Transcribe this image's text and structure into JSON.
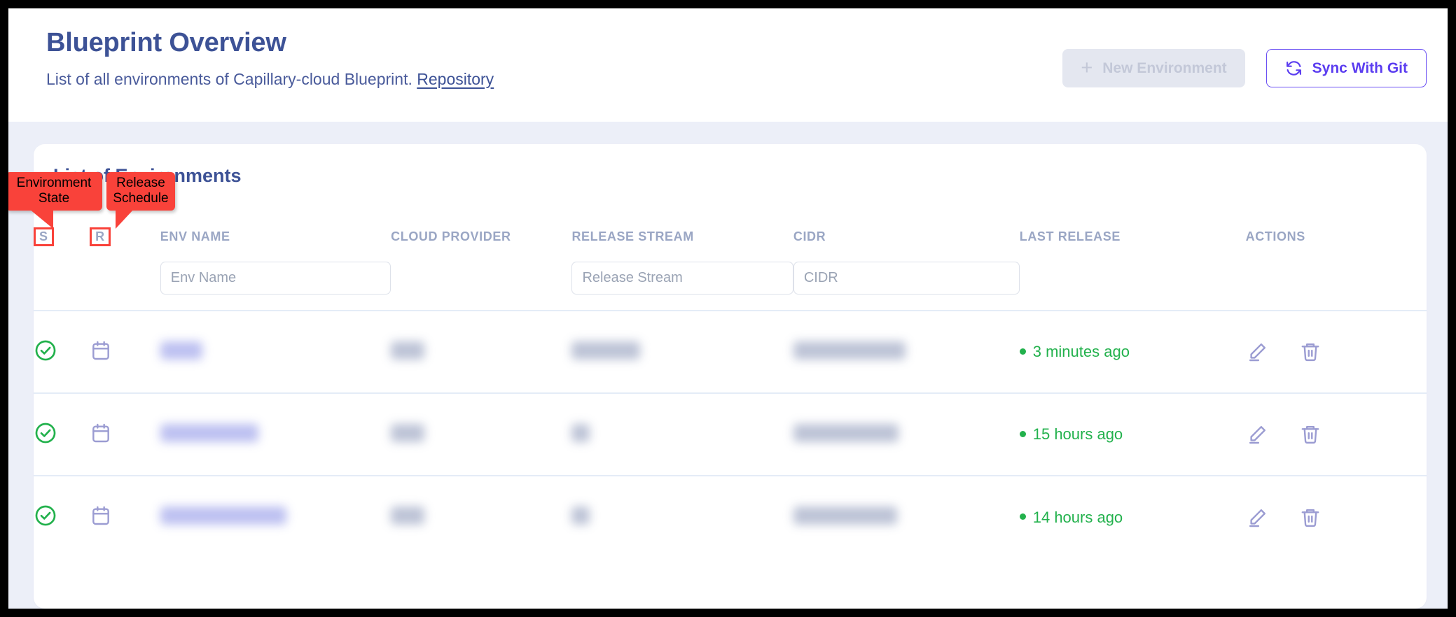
{
  "header": {
    "title": "Blueprint Overview",
    "subtitle_prefix": "List of all environments of Capillary-cloud Blueprint.",
    "repository_link": "Repository",
    "new_environment_label": "New Environment",
    "new_environment_icon": "plus-icon",
    "new_environment_disabled": true,
    "sync_label": "Sync With Git",
    "sync_icon": "refresh-icon",
    "accent_purple": "#5b3df0",
    "title_color": "#3d5296"
  },
  "card": {
    "title": "List of Environments"
  },
  "annotations": [
    {
      "id": "environment-state",
      "text": "Environment State",
      "target": "S",
      "color": "#f9423a"
    },
    {
      "id": "release-schedule",
      "text": "Release Schedule",
      "target": "R",
      "color": "#f9423a"
    }
  ],
  "table": {
    "columns": [
      {
        "key": "state",
        "label": "S",
        "highlighted": true
      },
      {
        "key": "release",
        "label": "R",
        "highlighted": true
      },
      {
        "key": "env_name",
        "label": "ENV NAME",
        "highlighted": false
      },
      {
        "key": "cloud_provider",
        "label": "CLOUD PROVIDER",
        "highlighted": false
      },
      {
        "key": "release_stream",
        "label": "RELEASE STREAM",
        "highlighted": false
      },
      {
        "key": "cidr",
        "label": "CIDR",
        "highlighted": false
      },
      {
        "key": "last_release",
        "label": "LAST RELEASE",
        "highlighted": false
      },
      {
        "key": "actions",
        "label": "ACTIONS",
        "highlighted": false
      }
    ],
    "filters": {
      "env_name_placeholder": "Env Name",
      "env_name_value": "",
      "release_stream_placeholder": "Release Stream",
      "release_stream_value": "",
      "cidr_placeholder": "CIDR",
      "cidr_value": ""
    },
    "rows": [
      {
        "state_icon": "check-circle-icon",
        "state_color": "#22b14c",
        "release_icon": "calendar-icon",
        "release_color": "#9b9cd2",
        "env_name": "",
        "env_name_redacted": true,
        "cloud_provider": "",
        "cloud_provider_redacted": true,
        "release_stream": "",
        "release_stream_redacted": true,
        "cidr": "",
        "cidr_redacted": true,
        "last_release": "3 minutes ago",
        "last_release_color": "#22b14c",
        "actions": [
          "edit-icon",
          "delete-icon"
        ]
      },
      {
        "state_icon": "check-circle-icon",
        "state_color": "#22b14c",
        "release_icon": "calendar-icon",
        "release_color": "#9b9cd2",
        "env_name": "",
        "env_name_redacted": true,
        "cloud_provider": "",
        "cloud_provider_redacted": true,
        "release_stream": "",
        "release_stream_redacted": true,
        "cidr": "",
        "cidr_redacted": true,
        "last_release": "15 hours ago",
        "last_release_color": "#22b14c",
        "actions": [
          "edit-icon",
          "delete-icon"
        ]
      },
      {
        "state_icon": "check-circle-icon",
        "state_color": "#22b14c",
        "release_icon": "calendar-icon",
        "release_color": "#9b9cd2",
        "env_name": "",
        "env_name_redacted": true,
        "cloud_provider": "",
        "cloud_provider_redacted": true,
        "release_stream": "",
        "release_stream_redacted": true,
        "cidr": "",
        "cidr_redacted": true,
        "last_release": "14 hours ago",
        "last_release_color": "#22b14c",
        "actions": [
          "edit-icon",
          "delete-icon"
        ]
      }
    ]
  }
}
